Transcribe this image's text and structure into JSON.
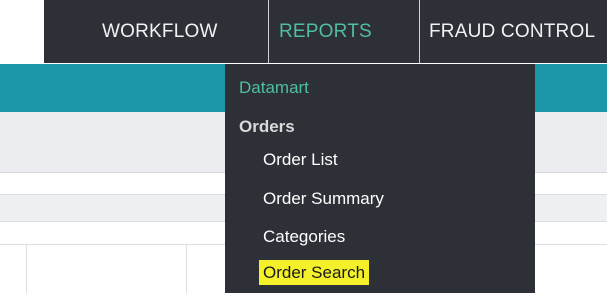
{
  "nav": {
    "workflow": "WORKFLOW",
    "reports": "REPORTS",
    "fraud_control": "FRAUD CONTROL"
  },
  "reports_menu": {
    "datamart": "Datamart",
    "orders_heading": "Orders",
    "order_list": "Order List",
    "order_summary": "Order Summary",
    "categories": "Categories",
    "order_search": "Order Search"
  },
  "colors": {
    "nav_background": "#2e3038",
    "active_accent": "#4fbf9f",
    "teal_band": "#1c96a9",
    "highlight": "#f4f12a"
  }
}
